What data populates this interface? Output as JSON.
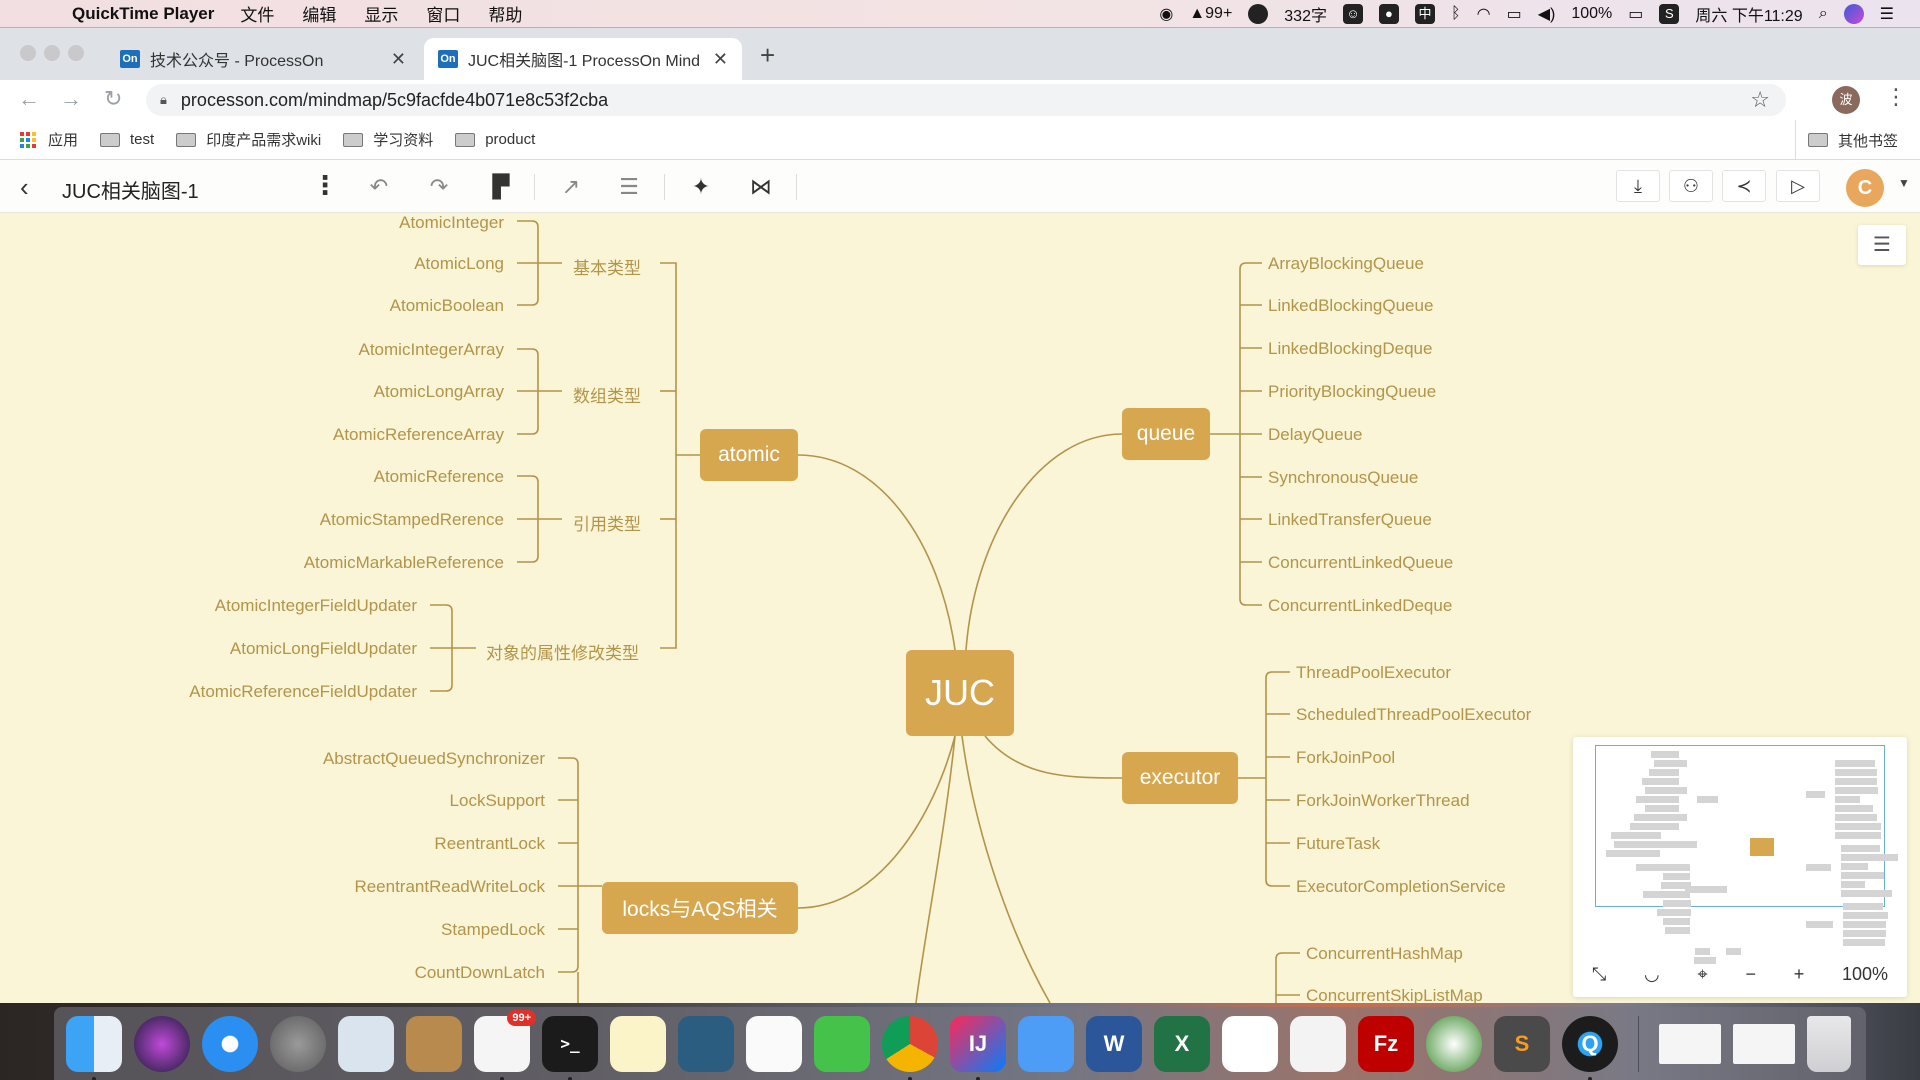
{
  "menubar": {
    "app_name": "QuickTime Player",
    "menus": [
      "文件",
      "编辑",
      "显示",
      "窗口",
      "帮助"
    ],
    "status": {
      "qq_count": "99+",
      "word_count": "332字",
      "input_method": "中",
      "battery": "100%",
      "clock": "周六 下午11:29"
    }
  },
  "browser": {
    "tabs": [
      {
        "favicon": "On",
        "title": "技术公众号 - ProcessOn",
        "active": false
      },
      {
        "favicon": "On",
        "title": "JUC相关脑图-1 ProcessOn Mind",
        "active": true
      }
    ],
    "url": "processon.com/mindmap/5c9facfde4b071e8c53f2cba",
    "profile_initial": "波",
    "bookmarks": [
      {
        "label": "应用",
        "icon": "apps-grid-icon"
      },
      {
        "label": "test",
        "icon": "folder-icon"
      },
      {
        "label": "印度产品需求wiki",
        "icon": "folder-icon"
      },
      {
        "label": "学习资料",
        "icon": "folder-icon"
      },
      {
        "label": "product",
        "icon": "folder-icon"
      }
    ],
    "other_bookmarks": "其他书签"
  },
  "app": {
    "doc_title": "JUC相关脑图-1",
    "user_initial": "C",
    "zoom_level": "100%",
    "accent_color": "#d6a74e",
    "canvas_color": "#f9f5d6",
    "line_color": "#b39449"
  },
  "mindmap": {
    "root": "JUC",
    "atomic": {
      "label": "atomic",
      "groups": [
        {
          "label": "基本类型",
          "items": [
            "AtomicInteger",
            "AtomicLong",
            "AtomicBoolean"
          ]
        },
        {
          "label": "数组类型",
          "items": [
            "AtomicIntegerArray",
            "AtomicLongArray",
            "AtomicReferenceArray"
          ]
        },
        {
          "label": "引用类型",
          "items": [
            "AtomicReference",
            "AtomicStampedRerence",
            "AtomicMarkableReference"
          ]
        },
        {
          "label": "对象的属性修改类型",
          "items": [
            "AtomicIntegerFieldUpdater",
            "AtomicLongFieldUpdater",
            "AtomicReferenceFieldUpdater"
          ]
        }
      ]
    },
    "queue": {
      "label": "queue",
      "items": [
        "ArrayBlockingQueue",
        "LinkedBlockingQueue",
        "LinkedBlockingDeque",
        "PriorityBlockingQueue",
        "DelayQueue",
        "SynchronousQueue",
        "LinkedTransferQueue",
        "ConcurrentLinkedQueue",
        "ConcurrentLinkedDeque"
      ]
    },
    "executor": {
      "label": "executor",
      "items": [
        "ThreadPoolExecutor",
        "ScheduledThreadPoolExecutor",
        "ForkJoinPool",
        "ForkJoinWorkerThread",
        "FutureTask",
        "ExecutorCompletionService"
      ]
    },
    "locks": {
      "label": "locks与AQS相关",
      "items": [
        "AbstractQueuedSynchronizer",
        "LockSupport",
        "ReentrantLock",
        "ReentrantReadWriteLock",
        "StampedLock",
        "CountDownLatch"
      ]
    },
    "collections": {
      "items": [
        "ConcurrentHashMap",
        "ConcurrentSkipListMap"
      ]
    }
  },
  "dock": [
    {
      "name": "finder",
      "label": "",
      "running": true
    },
    {
      "name": "siri",
      "label": "",
      "running": false
    },
    {
      "name": "safari",
      "label": "",
      "running": false
    },
    {
      "name": "launchpad",
      "label": "",
      "running": false
    },
    {
      "name": "mail",
      "label": "",
      "running": false
    },
    {
      "name": "contacts",
      "label": "",
      "running": false
    },
    {
      "name": "qq",
      "label": "",
      "badge": "99+",
      "running": true
    },
    {
      "name": "terminal",
      "label": ">_",
      "running": true
    },
    {
      "name": "notes",
      "label": "",
      "running": false
    },
    {
      "name": "mysql-workbench",
      "label": "",
      "running": false
    },
    {
      "name": "reminders",
      "label": "",
      "running": false
    },
    {
      "name": "wechat",
      "label": "",
      "running": false
    },
    {
      "name": "chrome",
      "label": "",
      "running": true
    },
    {
      "name": "intellij",
      "label": "IJ",
      "running": true
    },
    {
      "name": "feishu",
      "label": "",
      "running": false
    },
    {
      "name": "word",
      "label": "W",
      "running": false
    },
    {
      "name": "excel",
      "label": "X",
      "running": false
    },
    {
      "name": "baidu-netdisk",
      "label": "",
      "running": false
    },
    {
      "name": "textedit",
      "label": "",
      "running": false
    },
    {
      "name": "filezilla",
      "label": "Fz",
      "running": false
    },
    {
      "name": "anyconnect",
      "label": "",
      "running": false
    },
    {
      "name": "sublime",
      "label": "S",
      "running": false
    },
    {
      "name": "quicktime",
      "label": "Q",
      "running": true
    }
  ]
}
